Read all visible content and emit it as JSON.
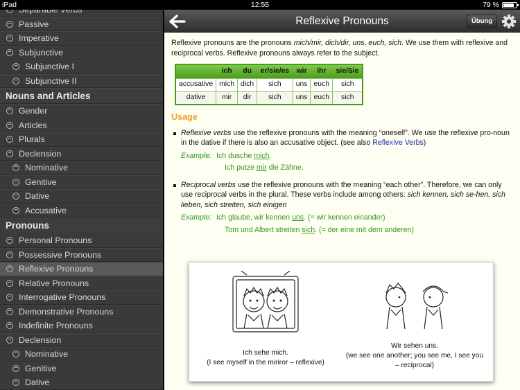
{
  "status": {
    "device": "iPad",
    "time": "12:55",
    "battery": "79 %"
  },
  "sidebar": {
    "items": [
      {
        "label": "Separable Verbs",
        "level": 1
      },
      {
        "label": "Passive",
        "level": 1
      },
      {
        "label": "Imperative",
        "level": 1
      },
      {
        "label": "Subjunctive",
        "level": 1
      },
      {
        "label": "Subjunctive I",
        "level": 2
      },
      {
        "label": "Subjunctive II",
        "level": 2
      },
      {
        "label": "Nouns and Articles",
        "level": 0
      },
      {
        "label": "Gender",
        "level": 1
      },
      {
        "label": "Articles",
        "level": 1
      },
      {
        "label": "Plurals",
        "level": 1
      },
      {
        "label": "Declension",
        "level": 1
      },
      {
        "label": "Nominative",
        "level": 2
      },
      {
        "label": "Genitive",
        "level": 2
      },
      {
        "label": "Dative",
        "level": 2
      },
      {
        "label": "Accusative",
        "level": 2
      },
      {
        "label": "Pronouns",
        "level": 0
      },
      {
        "label": "Personal Pronouns",
        "level": 1
      },
      {
        "label": "Possessive Pronouns",
        "level": 1
      },
      {
        "label": "Reflexive Pronouns",
        "level": 1,
        "selected": true
      },
      {
        "label": "Relative Pronouns",
        "level": 1
      },
      {
        "label": "Interrogative Pronouns",
        "level": 1
      },
      {
        "label": "Demonstrative Pronouns",
        "level": 1
      },
      {
        "label": "Indefinite Pronouns",
        "level": 1
      },
      {
        "label": "Declension",
        "level": 1
      },
      {
        "label": "Nominative",
        "level": 2
      },
      {
        "label": "Genitive",
        "level": 2
      },
      {
        "label": "Dative",
        "level": 2
      }
    ]
  },
  "navbar": {
    "title": "Reflexive Pronouns",
    "uebung": "Übung"
  },
  "intro": {
    "t1": "Reflexive pronouns are the pronouns ",
    "t2": "mich/mir, dich/dir, uns, euch, sich",
    "t3": ". We use them with reflexive and reciprocal verbs. Reflexive pronouns always refer to the subject."
  },
  "table": {
    "headers": [
      "",
      "ich",
      "du",
      "er/sie/es",
      "wir",
      "ihr",
      "sie/Sie"
    ],
    "rows": [
      [
        "accusative",
        "mich",
        "dich",
        "sich",
        "uns",
        "euch",
        "sich"
      ],
      [
        "dative",
        "mir",
        "dir",
        "sich",
        "uns",
        "euch",
        "sich"
      ]
    ]
  },
  "usage": {
    "heading": "Usage",
    "b1": {
      "em": "Reflexive verbs",
      "text": " use the reflexive pronouns with the meaning “oneself”. We use the reflexive pro-noun in the dative if there is also an accusative object. (see also ",
      "link": "Reflexive Verbs",
      "end": ")",
      "ex_label": "Example:",
      "ex1a": "Ich dusche ",
      "ex1b": "mich",
      "ex1c": ".",
      "ex2a": "Ich putze ",
      "ex2b": "mir",
      "ex2c": " die Zähne."
    },
    "b2": {
      "em": "Reciprocal verbs",
      "text": " use the reflexive pronouns with the meaning “each other”. Therefore, we can only use reciprocal verbs in the plural. These verbs include among others: ",
      "em2": "sich kennen, sich se-hen, sich lieben, sich streiten, sich einigen",
      "ex_label": "Example:",
      "ex1a": "Ich glaube, wir kennen ",
      "ex1b": "uns",
      "ex1c": ". (= wir kennen einander)",
      "ex2a": "Tom und Albert streiten ",
      "ex2b": "sich",
      "ex2c": ". (= der eine mit dem anderen)"
    }
  },
  "figure": {
    "cap1a": "Ich sehe mich.",
    "cap1b": "(I see myself in the miriror – reflexive)",
    "cap2a": "Wir sehen uns.",
    "cap2b": "(we see one another; you see me, I see you – reciprocal)"
  }
}
